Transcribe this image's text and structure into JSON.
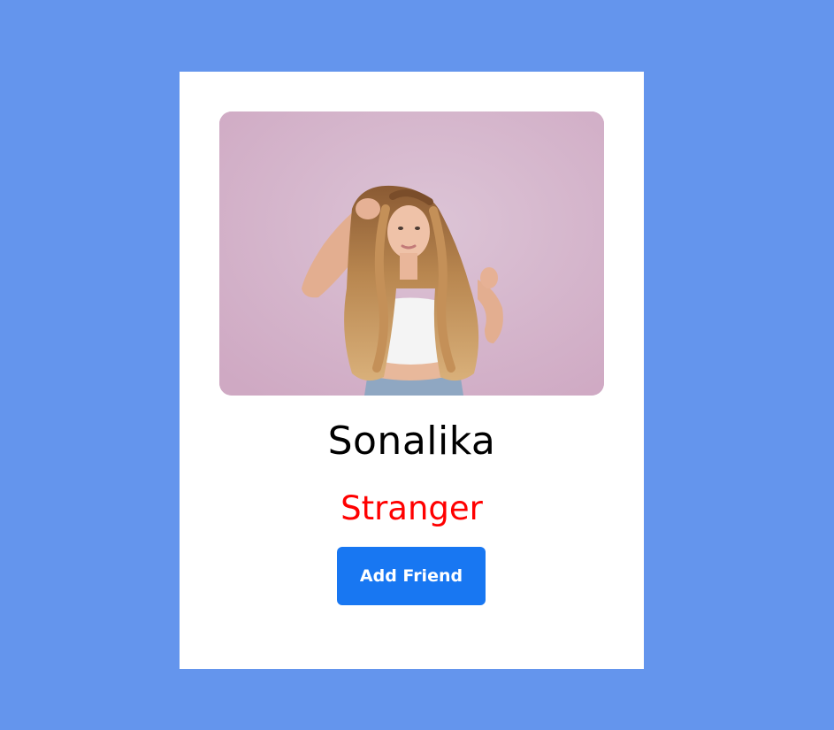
{
  "colors": {
    "page_background": "#6495ed",
    "card_background": "#ffffff",
    "status_color": "#ff0000",
    "button_background": "#1877f2",
    "button_text": "#ffffff"
  },
  "profile": {
    "photo_icon": "profile-photo-woman-long-hair",
    "name": "Sonalika",
    "status": "Stranger",
    "action_label": "Add Friend"
  }
}
